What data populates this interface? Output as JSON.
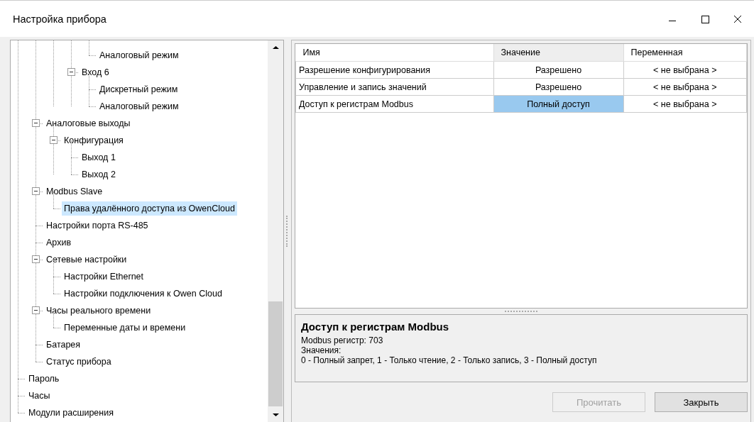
{
  "window": {
    "title": "Настройка прибора"
  },
  "tree": [
    {
      "children": [
        {
          "children": [
            {
              "children": [
                {
                  "children": [
                    {
                      "label": "Аналоговый режим",
                      "selected": false
                    }
                  ]
                },
                {
                  "label": "Вход 6",
                  "expanded": true,
                  "selected": false,
                  "children": [
                    {
                      "label": "Дискретный режим",
                      "selected": false
                    },
                    {
                      "label": "Аналоговый режим",
                      "selected": false
                    }
                  ]
                }
              ]
            }
          ]
        },
        {
          "label": "Аналоговые выходы",
          "expanded": true,
          "selected": false,
          "children": [
            {
              "label": "Конфигурация",
              "expanded": true,
              "selected": false,
              "children": [
                {
                  "label": "Выход 1",
                  "selected": false
                },
                {
                  "label": "Выход 2",
                  "selected": false
                }
              ]
            }
          ]
        },
        {
          "label": "Modbus Slave",
          "expanded": true,
          "selected": false,
          "children": [
            {
              "label": "Права удалённого доступа из OwenCloud",
              "selected": true
            }
          ]
        },
        {
          "label": "Настройки порта RS-485",
          "selected": false
        },
        {
          "label": "Архив",
          "selected": false
        },
        {
          "label": "Сетевые настройки",
          "expanded": true,
          "selected": false,
          "children": [
            {
              "label": "Настройки Ethernet",
              "selected": false
            },
            {
              "label": "Настройки подключения к Owen Cloud",
              "selected": false
            }
          ]
        },
        {
          "label": "Часы реального времени",
          "expanded": true,
          "selected": false,
          "children": [
            {
              "label": "Переменные даты и времени",
              "selected": false
            }
          ]
        },
        {
          "label": "Батарея",
          "selected": false
        },
        {
          "label": "Статус прибора",
          "selected": false
        }
      ]
    },
    {
      "label": "Пароль",
      "selected": false
    },
    {
      "label": "Часы",
      "selected": false
    },
    {
      "label": "Модули расширения",
      "selected": false
    }
  ],
  "table": {
    "columns": [
      {
        "label": "Имя",
        "selected": false
      },
      {
        "label": "Значение",
        "selected": true
      },
      {
        "label": "Переменная",
        "selected": false
      }
    ],
    "rows": [
      {
        "name": "Разрешение конфигурирования",
        "value": "Разрешено",
        "variable": "< не выбрана >",
        "selected": false
      },
      {
        "name": "Управление и запись значений",
        "value": "Разрешено",
        "variable": "< не выбрана >",
        "selected": false
      },
      {
        "name": "Доступ к регистрам Modbus",
        "value": "Полный доступ",
        "variable": "< не выбрана >",
        "selected": true
      }
    ]
  },
  "description": {
    "title": "Доступ к регистрам Modbus",
    "lines": [
      "Modbus регистр: 703",
      "Значения:",
      "0 - Полный запрет, 1 - Только чтение, 2 - Только запись, 3 - Полный доступ"
    ]
  },
  "buttons": [
    {
      "label": "Прочитать",
      "disabled": true
    },
    {
      "label": "Закрыть",
      "disabled": false
    }
  ]
}
